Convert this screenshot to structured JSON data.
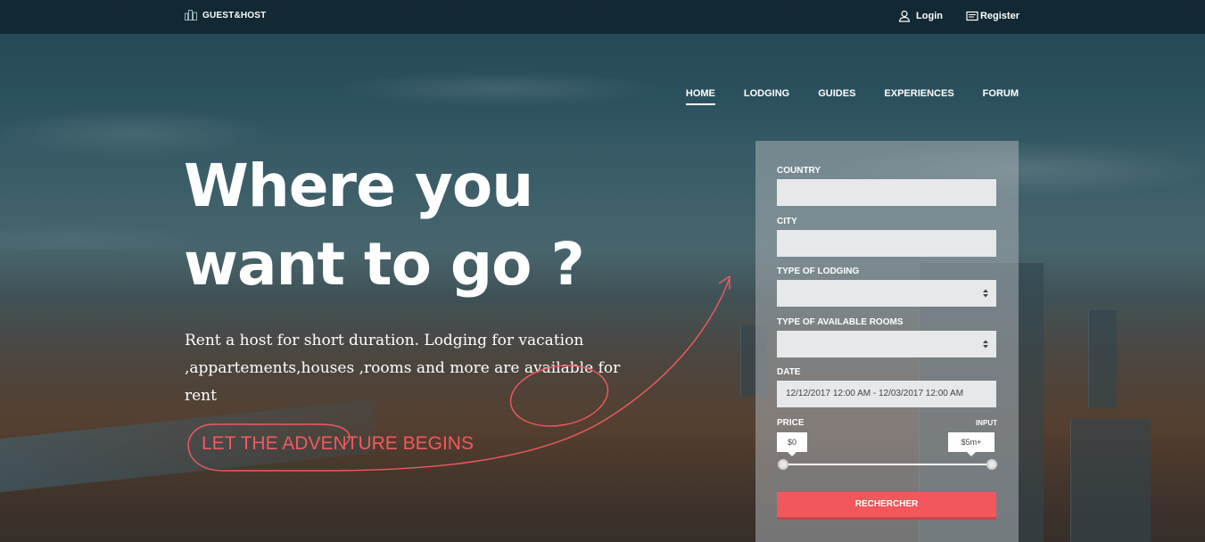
{
  "brand": {
    "name": "GUEST&HOST",
    "icon": "building-icon"
  },
  "auth": {
    "login_label": "Login",
    "login_icon": "user-icon",
    "register_label": "Register",
    "register_icon": "form-icon"
  },
  "nav": {
    "items": [
      {
        "label": "HOME",
        "active": true
      },
      {
        "label": "LODGING",
        "active": false
      },
      {
        "label": "GUIDES",
        "active": false
      },
      {
        "label": "EXPERIENCES",
        "active": false
      },
      {
        "label": "FORUM",
        "active": false
      }
    ]
  },
  "hero": {
    "title_line1": "Where you",
    "title_line2": "want to go ?",
    "subtitle_line1": "Rent a host for short duration. Lodging for vacation",
    "subtitle_line2": ",appartements,houses ,rooms and more are available for rent",
    "cta_label": "LET THE ADVENTURE BEGINS",
    "cta_color": "#f05a5f"
  },
  "search": {
    "country_label": "COUNTRY",
    "country_value": "",
    "city_label": "CITY",
    "city_value": "",
    "lodging_type_label": "TYPE OF LODGING",
    "lodging_type_value": "",
    "rooms_label": "TYPE OF AVAILABLE ROOMS",
    "rooms_value": "",
    "date_label": "DATE",
    "date_value": "12/12/2017  12:00 AM - 12/03/2017  12:00 AM",
    "price_label": "PRICE",
    "input_label": "INPUT",
    "price_min": "$0",
    "price_max": "$5m+",
    "price_range_fraction": [
      0,
      1
    ],
    "submit_label": "RECHERCHER",
    "submit_color": "#f2575c"
  }
}
